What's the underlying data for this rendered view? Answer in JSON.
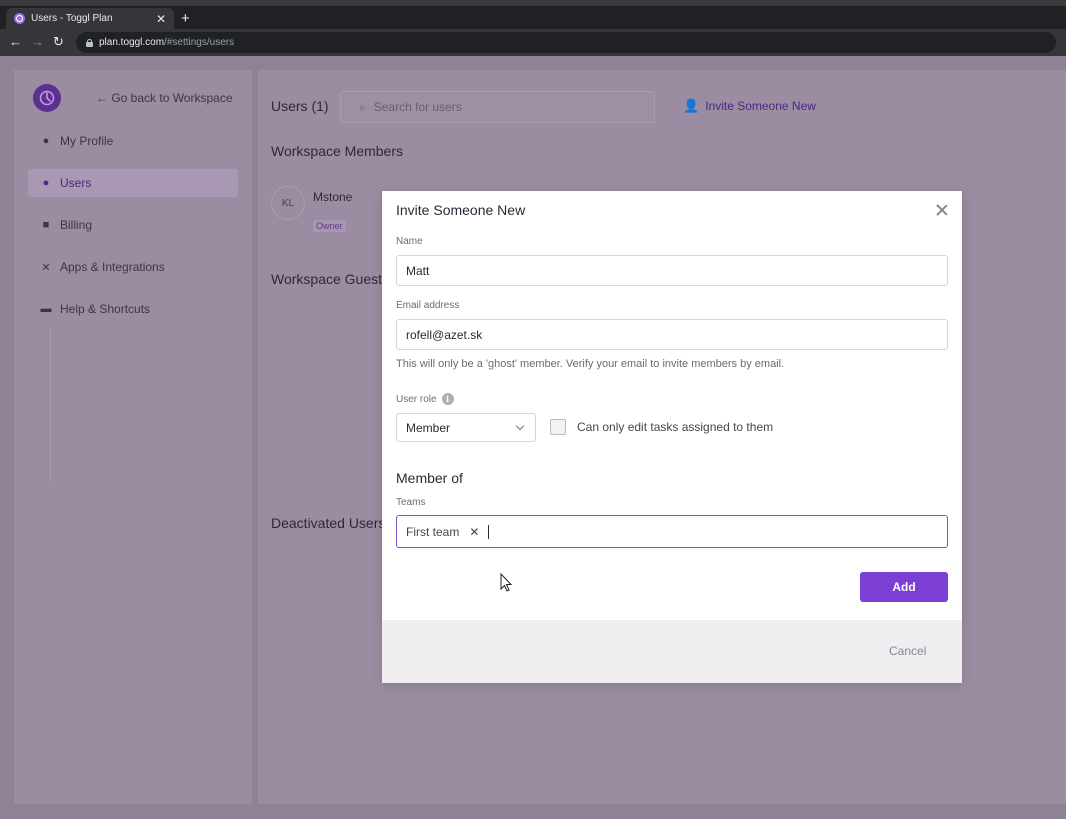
{
  "browser": {
    "tab_title": "Users - Toggl Plan",
    "url_domain": "plan.toggl.com",
    "url_path": "/#settings/users"
  },
  "sidebar": {
    "back_label": "← Go back to Workspace",
    "items": [
      {
        "label": "My Profile",
        "icon": "person-icon"
      },
      {
        "label": "Users",
        "icon": "users-icon",
        "active": true
      },
      {
        "label": "Billing",
        "icon": "wallet-icon"
      },
      {
        "label": "Apps & Integrations",
        "icon": "tools-icon"
      },
      {
        "label": "Help & Shortcuts",
        "icon": "chat-icon"
      }
    ]
  },
  "main": {
    "title": "Users (1)",
    "search_placeholder": "Search for users",
    "invite_label": "Invite Someone New",
    "members_heading": "Workspace Members",
    "member": {
      "initials": "KL",
      "name": "Mstone",
      "role": "Owner"
    },
    "guests_heading": "Workspace Guests",
    "deactivated_heading": "Deactivated Users"
  },
  "modal": {
    "title": "Invite Someone New",
    "name_label": "Name",
    "name_value": "Matt",
    "email_label": "Email address",
    "email_value": "rofell@azet.sk",
    "hint": "This will only be a 'ghost' member. Verify your email to invite members by email.",
    "role_label": "User role",
    "role_value": "Member",
    "checkbox_label": "Can only edit tasks assigned to them",
    "member_of": "Member of",
    "teams_label": "Teams",
    "team_tag": "First team",
    "add_label": "Add",
    "cancel_label": "Cancel"
  },
  "colors": {
    "accent": "#7b3fd4",
    "overlay": "#8f8296"
  }
}
